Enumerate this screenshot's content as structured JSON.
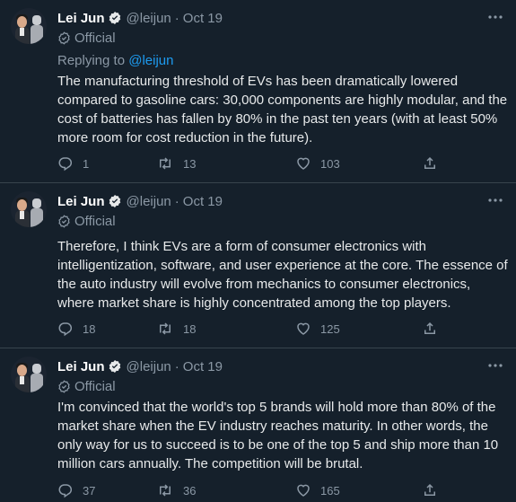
{
  "tweets": [
    {
      "name": "Lei Jun",
      "handle": "@leijun",
      "date": "Oct 19",
      "label": "Official",
      "replying_prefix": "Replying to",
      "replying_to": "@leijun",
      "text": "The manufacturing threshold of EVs has been dramatically lowered compared to gasoline cars: 30,000 components are highly modular, and the cost of batteries has fallen by 80% in the past ten years (with at least 50% more room for cost reduction in the future).",
      "replies": "1",
      "retweets": "13",
      "likes": "103"
    },
    {
      "name": "Lei Jun",
      "handle": "@leijun",
      "date": "Oct 19",
      "label": "Official",
      "text": "Therefore, I think EVs are a form of consumer electronics with intelligentization, software, and user experience at the core. The essence of the auto industry will evolve from mechanics to consumer electronics, where market share is highly concentrated among the top players.",
      "replies": "18",
      "retweets": "18",
      "likes": "125"
    },
    {
      "name": "Lei Jun",
      "handle": "@leijun",
      "date": "Oct 19",
      "label": "Official",
      "text": "I'm convinced that the world's top 5 brands will hold more than 80% of the market share when the EV industry reaches maturity. In other words, the only way for us to succeed is to be one of the top 5 and ship more than 10 million cars annually. The competition will be brutal.",
      "replies": "37",
      "retweets": "36",
      "likes": "165"
    }
  ],
  "icons": {
    "verified": "verified-badge-icon",
    "official": "official-badge-icon",
    "more": "more-options-icon",
    "reply": "reply-icon",
    "retweet": "retweet-icon",
    "like": "like-icon",
    "share": "share-icon"
  },
  "colors": {
    "background": "#15202b",
    "accent": "#1d9bf0",
    "secondary_text": "#8b98a5",
    "divider": "#38444d"
  }
}
